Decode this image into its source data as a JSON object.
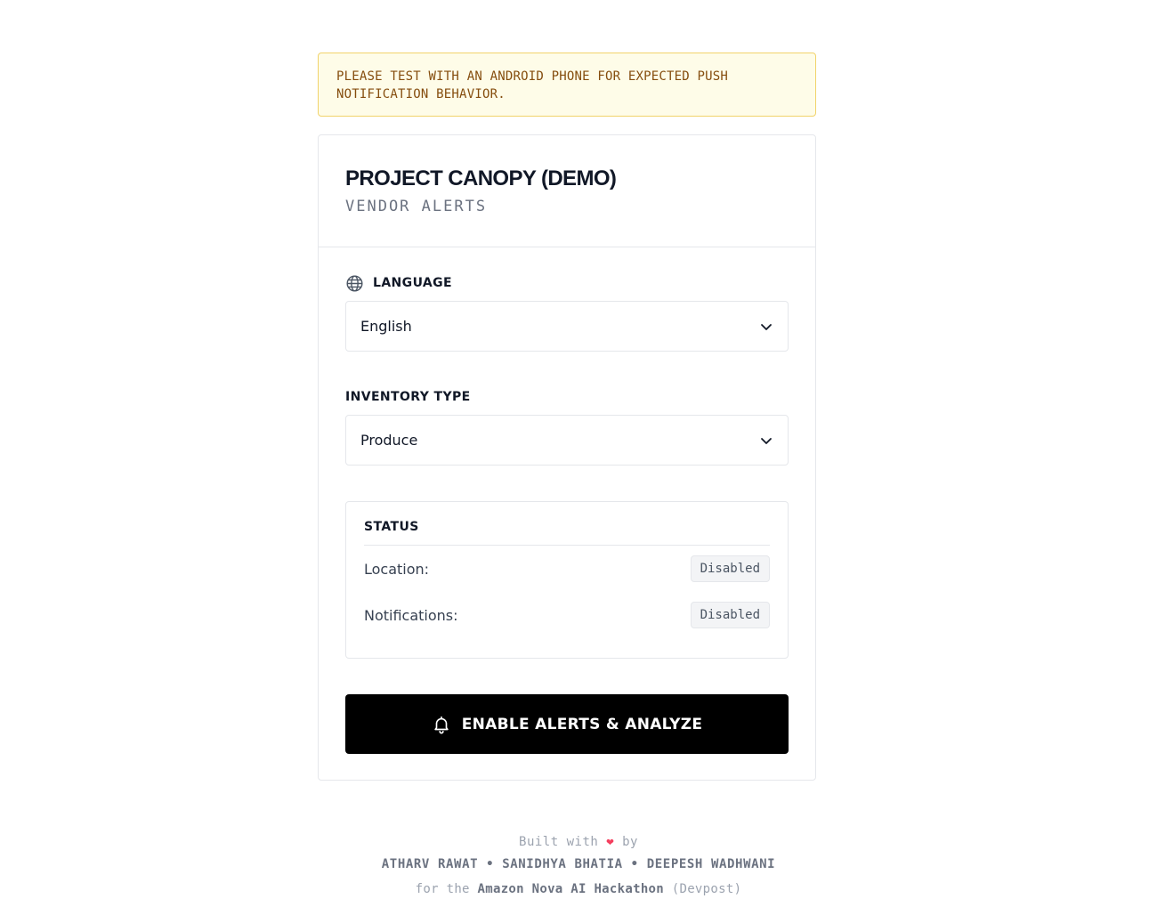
{
  "banner": {
    "text": "PLEASE TEST WITH AN ANDROID PHONE FOR EXPECTED PUSH NOTIFICATION BEHAVIOR."
  },
  "header": {
    "title": "PROJECT CANOPY (DEMO)",
    "subtitle": "VENDOR ALERTS"
  },
  "language": {
    "label": "LANGUAGE",
    "icon": "globe-icon",
    "selected": "English"
  },
  "inventory": {
    "label": "INVENTORY TYPE",
    "selected": "Produce"
  },
  "status": {
    "title": "STATUS",
    "rows": [
      {
        "label": "Location:",
        "value": "Disabled"
      },
      {
        "label": "Notifications:",
        "value": "Disabled"
      }
    ]
  },
  "cta": {
    "icon": "bell-icon",
    "label": "ENABLE ALERTS & ANALYZE"
  },
  "footer": {
    "built_prefix": "Built with",
    "heart": "❤",
    "built_suffix": "by",
    "authors": "ATHARV RAWAT • SANIDHYA BHATIA • DEEPESH WADHWANI",
    "for_prefix": "for the",
    "event": "Amazon Nova AI Hackathon",
    "platform": "(Devpost)"
  },
  "colors": {
    "banner_bg": "#fefce8",
    "banner_border": "#f1d36b",
    "banner_text": "#854d0e",
    "cta_bg": "#000000",
    "heart": "#f43f5e"
  }
}
